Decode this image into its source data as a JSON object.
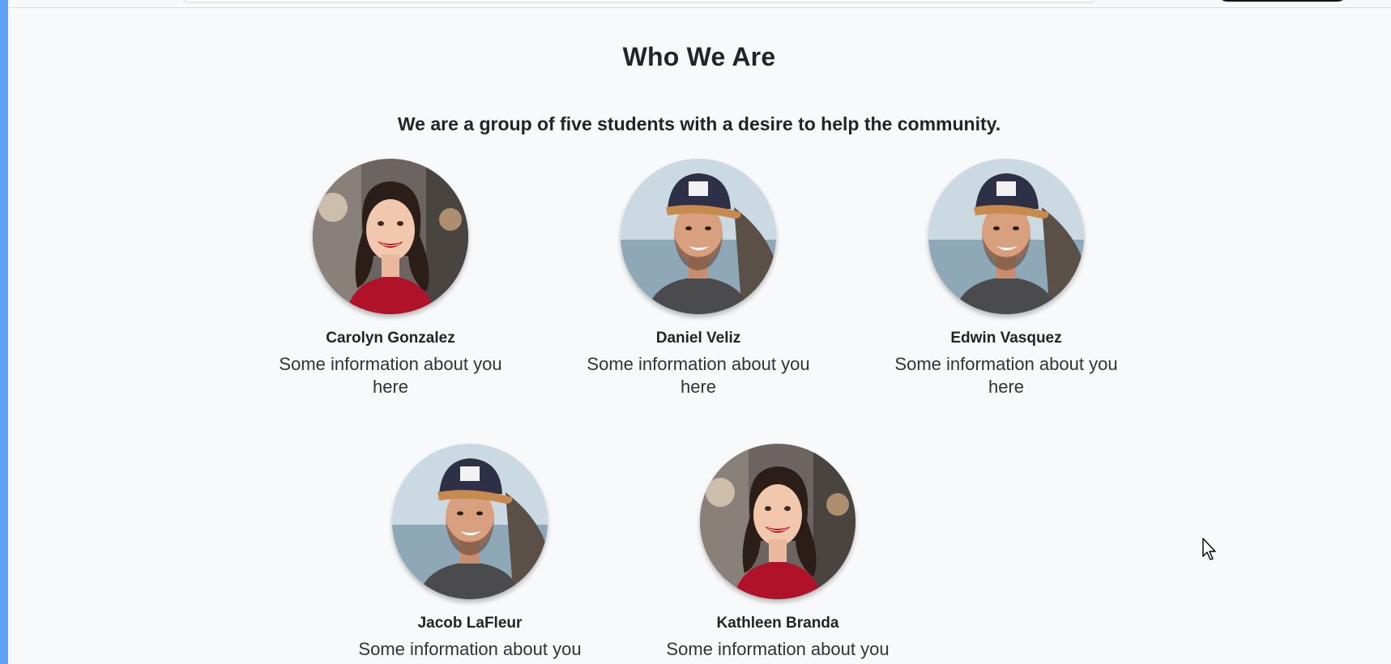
{
  "section": {
    "title": "Who We Are",
    "subtitle": "We are a group of five students with a desire to help the community."
  },
  "members": [
    {
      "name": "Carolyn Gonzalez",
      "info": "Some information about you here",
      "photo": "woman-portrait"
    },
    {
      "name": "Daniel Veliz",
      "info": "Some information about you here",
      "photo": "man-portrait"
    },
    {
      "name": "Edwin Vasquez",
      "info": "Some information about you here",
      "photo": "man-portrait"
    },
    {
      "name": "Jacob LaFleur",
      "info": "Some information about you",
      "photo": "man-portrait"
    },
    {
      "name": "Kathleen Branda",
      "info": "Some information about you",
      "photo": "woman-portrait"
    }
  ],
  "colors": {
    "accent_left_bar": "#5ea2f7",
    "page_background": "#f8f9fa"
  }
}
